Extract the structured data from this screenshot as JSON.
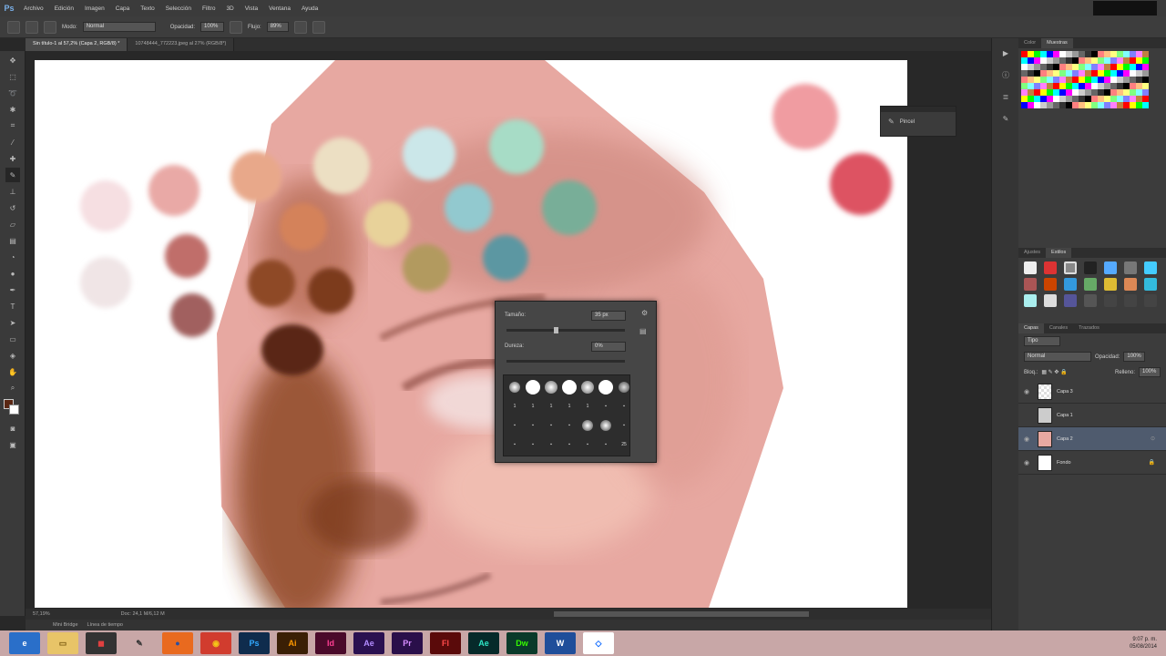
{
  "app": {
    "logo": "Ps"
  },
  "menu": [
    "Archivo",
    "Edición",
    "Imagen",
    "Capa",
    "Texto",
    "Selección",
    "Filtro",
    "3D",
    "Vista",
    "Ventana",
    "Ayuda"
  ],
  "options": {
    "mode_label": "Modo:",
    "mode_value": "Normal",
    "opacity_label": "Opacidad:",
    "opacity_value": "100%",
    "flow_label": "Flujo:",
    "flow_value": "89%"
  },
  "document_tabs": [
    {
      "label": "Sin título-1 al 57,2% (Capa 2, RGB/8) *",
      "active": true
    },
    {
      "label": "10748444_772223.jpeg al 27% (RGB/8*)",
      "active": false
    }
  ],
  "status": {
    "zoom": "57,19%",
    "doc": "Doc: 24,1 M/6,12 M"
  },
  "minibridge": {
    "tab1": "Mini Bridge",
    "tab2": "Línea de tiempo"
  },
  "brush_picker": {
    "size_label": "Tamaño:",
    "size_value": "35 px",
    "hardness_label": "Dureza:",
    "hardness_value": "0%",
    "brush_sizes": [
      "",
      "",
      "",
      "",
      "",
      "",
      "",
      "1",
      "1",
      "1",
      "1",
      "1",
      "",
      "",
      "",
      "",
      "",
      "",
      "",
      "",
      "",
      "",
      "",
      "",
      "",
      "",
      "",
      "",
      "25"
    ]
  },
  "minipanel": {
    "label": "Pincel"
  },
  "swatch_panel": {
    "tabs": [
      "Color",
      "Muestras"
    ],
    "active": "Muestras"
  },
  "styles_panel": {
    "tabs": [
      "Ajustes",
      "Estilos"
    ],
    "active": "Estilos"
  },
  "layers_panel": {
    "tabs": [
      "Capas",
      "Canales",
      "Trazados"
    ],
    "filter_label": "Tipo",
    "blend_mode": "Normal",
    "opacity_label": "Opacidad:",
    "opacity_value": "100%",
    "lock_label": "Bloq.:",
    "fill_label": "Relleno:",
    "fill_value": "100%",
    "layers": [
      {
        "name": "Capa 3",
        "selected": false
      },
      {
        "name": "Capa 1",
        "selected": false
      },
      {
        "name": "Capa 2",
        "selected": true
      },
      {
        "name": "Fondo",
        "selected": false
      }
    ]
  },
  "taskbar": {
    "apps": [
      {
        "name": "internet-explorer-icon",
        "glyph": "e",
        "bg": "#2a6fc9",
        "fg": "#ffffff"
      },
      {
        "name": "file-explorer-icon",
        "glyph": "▭",
        "bg": "#e8c468",
        "fg": "#7a5a10"
      },
      {
        "name": "paint-icon",
        "glyph": "◼",
        "bg": "#333333",
        "fg": "#e04040"
      },
      {
        "name": "pen-tool-icon",
        "glyph": "✎",
        "bg": "#c8a7a7",
        "fg": "#333333"
      },
      {
        "name": "firefox-icon",
        "glyph": "●",
        "bg": "#e96a1f",
        "fg": "#2c4fa0"
      },
      {
        "name": "chrome-icon",
        "glyph": "◉",
        "bg": "#d13c2e",
        "fg": "#f5c518"
      },
      {
        "name": "photoshop-icon",
        "glyph": "Ps",
        "bg": "#0f2c4d",
        "fg": "#31a8ff"
      },
      {
        "name": "illustrator-icon",
        "glyph": "Ai",
        "bg": "#3a1f05",
        "fg": "#ff9a00"
      },
      {
        "name": "indesign-icon",
        "glyph": "Id",
        "bg": "#4a0a2a",
        "fg": "#ff3f94"
      },
      {
        "name": "edge-animate-icon",
        "glyph": "Ae",
        "bg": "#2a1050",
        "fg": "#b38cff"
      },
      {
        "name": "premiere-icon",
        "glyph": "Pr",
        "bg": "#2a0f4a",
        "fg": "#d68cff"
      },
      {
        "name": "flash-icon",
        "glyph": "Fl",
        "bg": "#5a0a0a",
        "fg": "#ff4a4a"
      },
      {
        "name": "media-encoder-icon",
        "glyph": "Ae",
        "bg": "#062a2a",
        "fg": "#2ee6c6"
      },
      {
        "name": "dreamweaver-icon",
        "glyph": "Dw",
        "bg": "#0a3a2a",
        "fg": "#35fa00"
      },
      {
        "name": "word-icon",
        "glyph": "W",
        "bg": "#1f4e9a",
        "fg": "#ffffff"
      },
      {
        "name": "dropbox-icon",
        "glyph": "◇",
        "bg": "#ffffff",
        "fg": "#0061ff"
      }
    ],
    "time": "9:07 p. m.",
    "date": "05/08/2014"
  },
  "colors": {
    "face": "#e7a8a1",
    "palette": [
      "#f6dfe2",
      "#e9a9a6",
      "#e8a88a",
      "#ecdfc3",
      "#cbe7e9",
      "#a7dcc6",
      "#f0e5e6",
      "#c06e6a",
      "#d4825a",
      "#e8d29a",
      "#92c9cf",
      "#78ae98",
      "#a1605e",
      "#8e4a26",
      "#7c3b1f",
      "#b29a5e",
      "#5b97a2",
      "#5a2713",
      "#f09ca1",
      "#dd5262"
    ]
  }
}
